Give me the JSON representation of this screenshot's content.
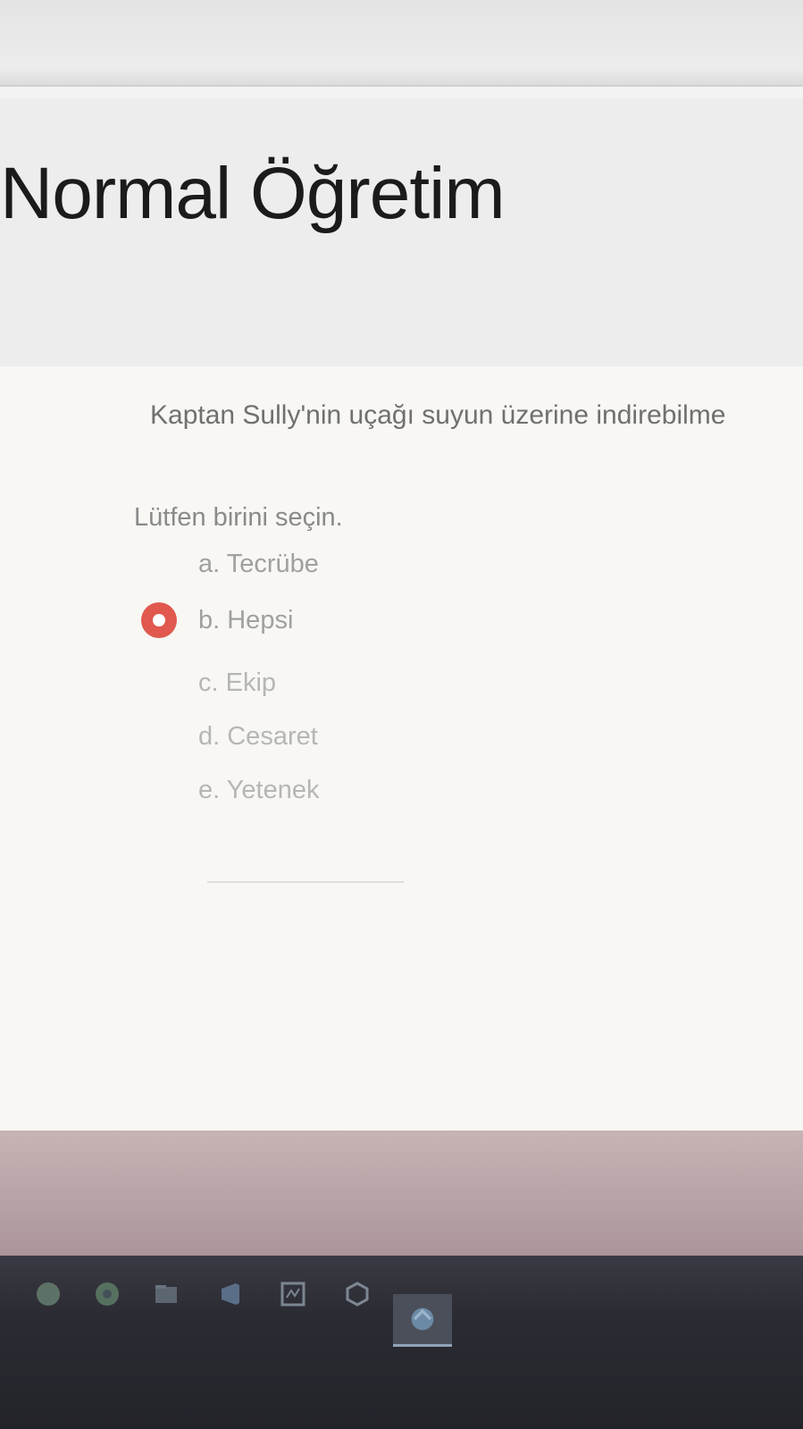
{
  "page": {
    "title": "Normal Öğretim"
  },
  "question": {
    "text": "Kaptan Sully'nin uçağı suyun üzerine indirebilme",
    "prompt": "Lütfen birini seçin.",
    "options": [
      {
        "label": "a. Tecrübe",
        "selected": false
      },
      {
        "label": "b. Hepsi",
        "selected": true
      },
      {
        "label": "c. Ekip",
        "selected": false
      },
      {
        "label": "d. Cesaret",
        "selected": false
      },
      {
        "label": "e. Yetenek",
        "selected": false
      }
    ],
    "selected_color": "#e0584e"
  },
  "taskbar": {
    "icons": [
      "whatsapp-icon",
      "chrome-icon",
      "file-explorer-icon",
      "visual-studio-icon",
      "app-icon",
      "box-icon",
      "active-window-icon"
    ]
  }
}
